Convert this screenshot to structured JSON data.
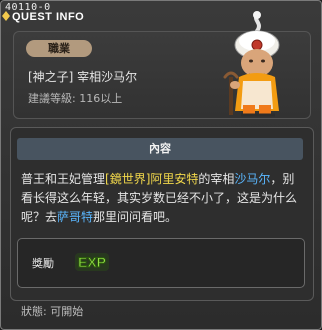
{
  "window": {
    "quest_id": "40110-0",
    "title": "QUEST INFO"
  },
  "npc": {
    "job_label": "職業",
    "name": "[神之子] 宰相沙马尔",
    "level": "建議等級: 116以上"
  },
  "content": {
    "header": "內容",
    "desc_parts": [
      "普王和王妃管理",
      "[鏡世界]阿里安特",
      "的宰相",
      "沙马尔",
      "，别看长得这么年轻，其实岁数已经不小了，这是为什么呢？去",
      "萨哥特",
      "那里问问看吧。"
    ]
  },
  "reward": {
    "label": "獎勵",
    "exp_text": "EXP"
  },
  "status": "狀態: 可開始"
}
